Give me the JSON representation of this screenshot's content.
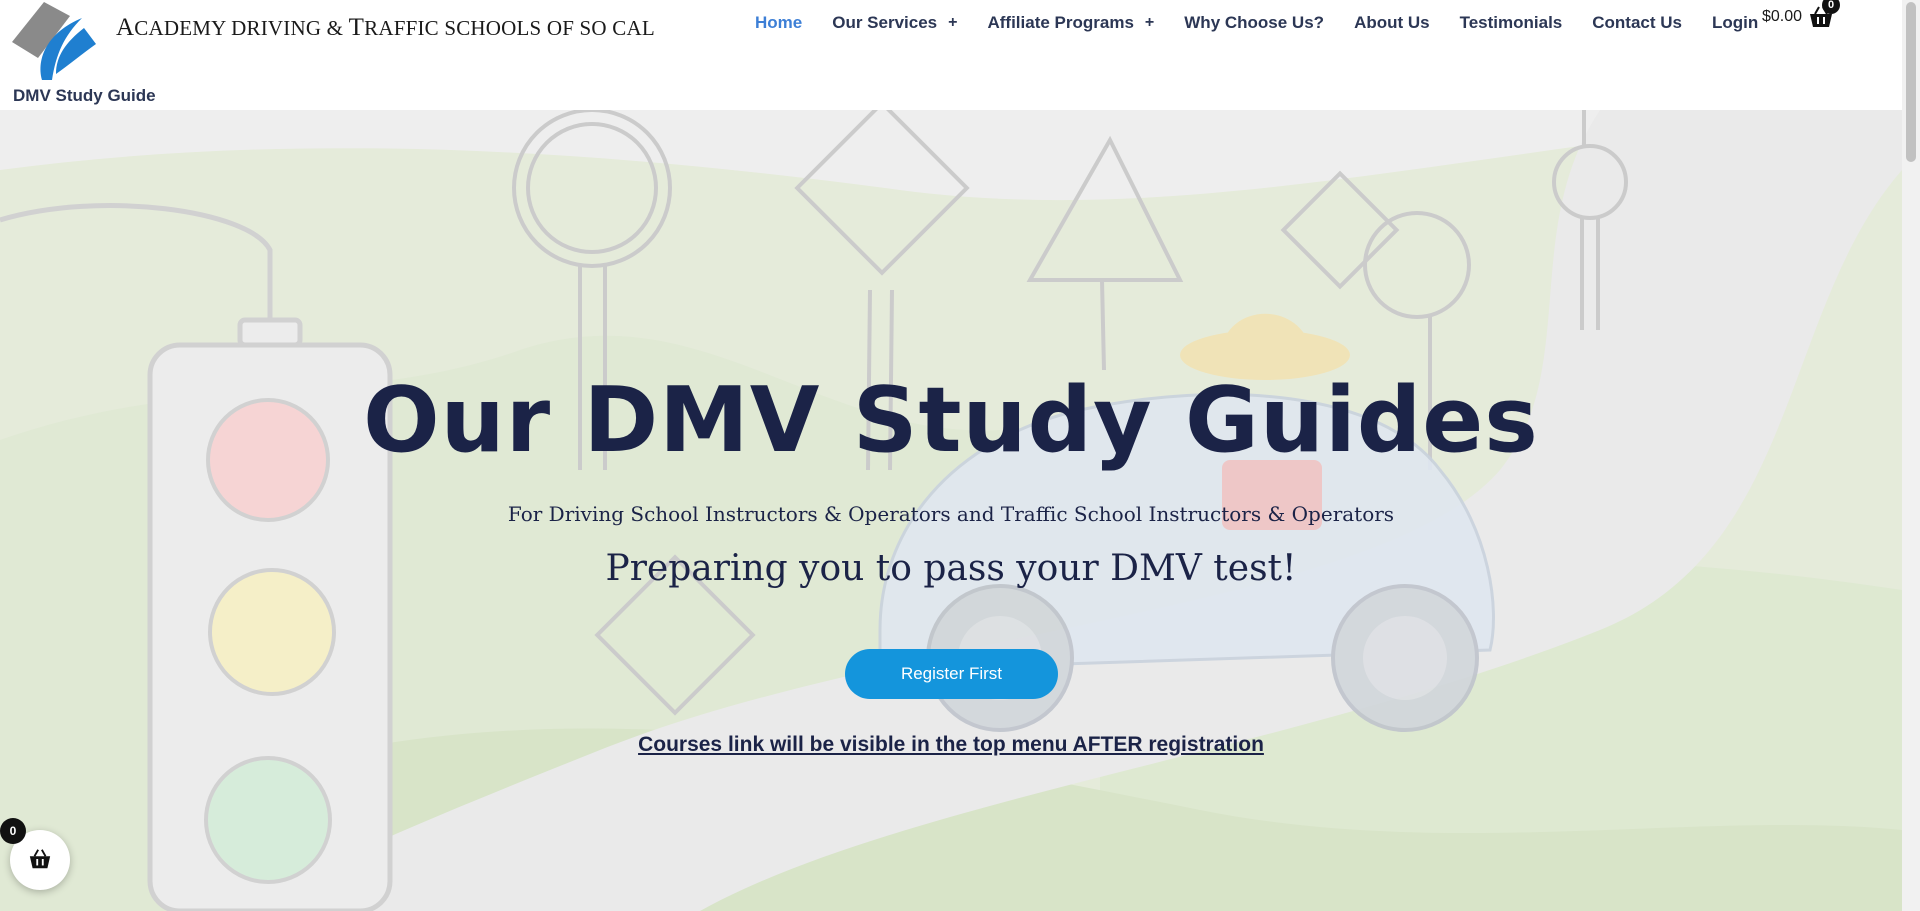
{
  "header": {
    "logo_text_cap1": "A",
    "logo_text_1": "CADEMY DRIVING",
    "logo_text_amp": "&",
    "logo_text_cap2": "T",
    "logo_text_2": "RAFFIC SCHOOLS OF SO CAL",
    "sub_link": "DMV Study Guide"
  },
  "nav": {
    "items": [
      {
        "label": "Home",
        "active": true
      },
      {
        "label": "Our Services",
        "has_children": true
      },
      {
        "label": "Affiliate Programs",
        "has_children": true
      },
      {
        "label": "Why Choose Us?"
      },
      {
        "label": "About Us"
      },
      {
        "label": "Testimonials"
      },
      {
        "label": "Contact Us"
      },
      {
        "label": "Login"
      }
    ],
    "plus_symbol": "+",
    "cart_amount": "$0.00",
    "cart_count": "0",
    "active_color": "#3d7fd6"
  },
  "hero": {
    "title": "Our DMV Study Guides",
    "subtitle": "For Driving School Instructors & Operators and Traffic School Instructors & Operators",
    "tagline": "Preparing you to pass your DMV test!",
    "button": "Register First",
    "note": "Courses link will be visible in the top menu AFTER registration",
    "title_color": "#1b2347",
    "button_color": "#1495dc"
  },
  "floating_cart": {
    "count": "0"
  },
  "icons": [
    "logo-mark",
    "plus-icon",
    "cart-icon",
    "basket-icon"
  ]
}
